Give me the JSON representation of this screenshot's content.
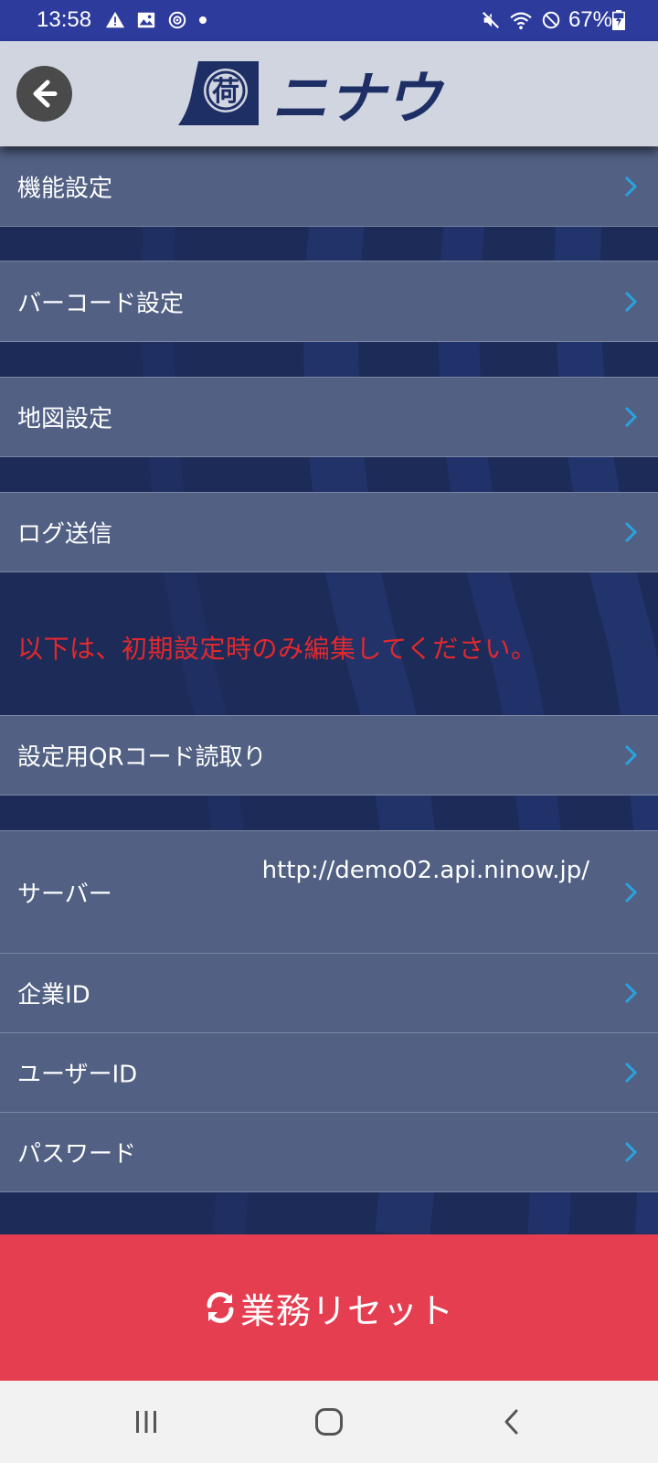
{
  "status_bar": {
    "time": "13:58",
    "battery_percent": "67%",
    "left_icons": [
      "alert-icon",
      "image-icon",
      "sync-icon",
      "dot-icon"
    ],
    "right_icons": [
      "mute-icon",
      "wifi-icon",
      "do-not-disturb-icon",
      "battery-charging-icon"
    ]
  },
  "header": {
    "back_icon": "arrow-left-icon",
    "logo_kanji": "荷",
    "logo_text": "ニナウ"
  },
  "menu": {
    "items": [
      {
        "label": "機能設定"
      },
      {
        "label": "バーコード設定"
      },
      {
        "label": "地図設定"
      },
      {
        "label": "ログ送信"
      }
    ],
    "notice": "以下は、初期設定時のみ編集してください。",
    "initial_items": [
      {
        "label": "設定用QRコード読取り"
      },
      {
        "label": "サーバー",
        "value": "http://demo02.api.ninow.jp/"
      },
      {
        "label": "企業ID"
      },
      {
        "label": "ユーザーID"
      },
      {
        "label": "パスワード"
      }
    ]
  },
  "reset_button": {
    "icon": "refresh-icon",
    "label": "業務リセット"
  },
  "nav_bar": {
    "buttons": [
      "recent-apps-icon",
      "home-icon",
      "back-icon"
    ]
  },
  "colors": {
    "status_bar": "#2d3b9c",
    "header": "#d1d5e0",
    "background": "#1c2b57",
    "row": "#516083",
    "chevron": "#29a3e0",
    "notice": "#e3292e",
    "reset": "#e63e51",
    "logo": "#1e2f66"
  }
}
